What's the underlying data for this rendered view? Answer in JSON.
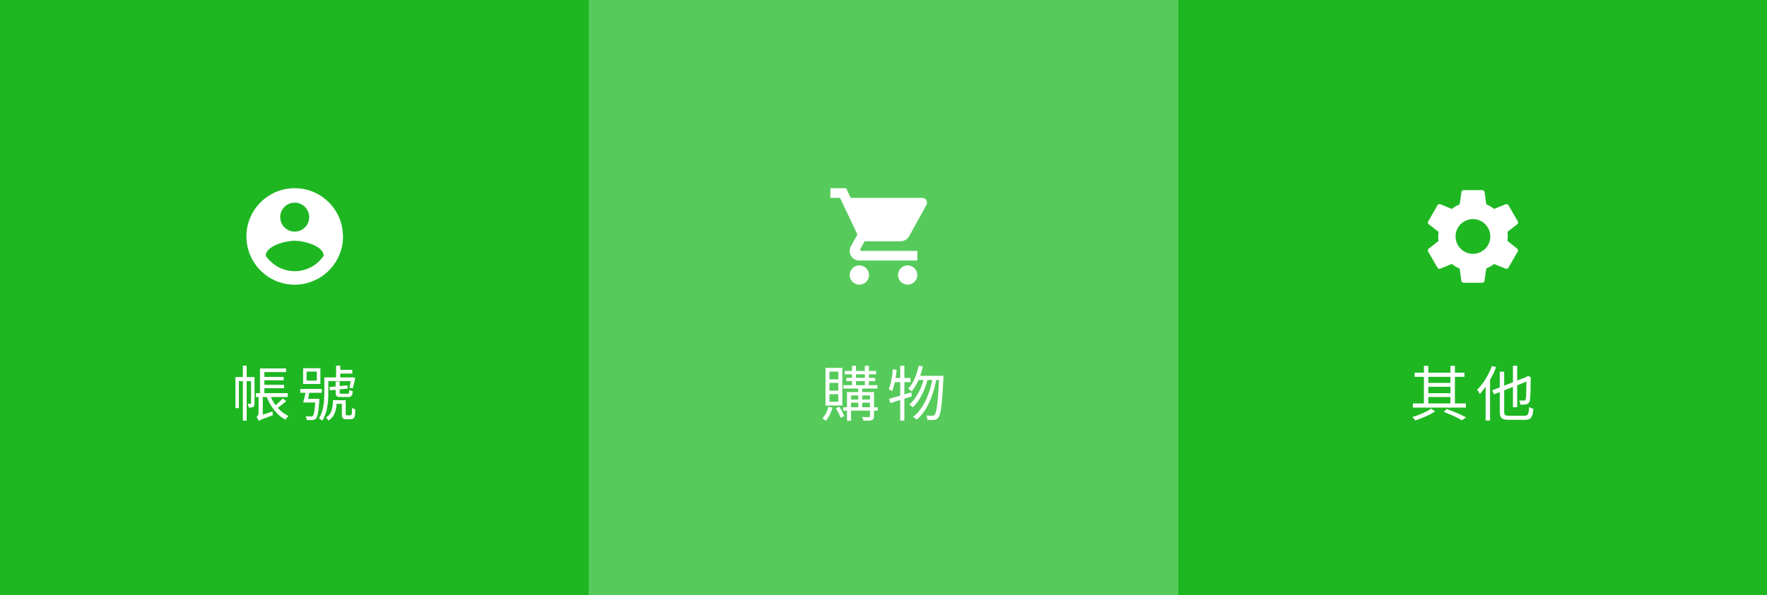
{
  "colors": {
    "background": "#1eb722",
    "selected_background": "#56cb5b",
    "foreground": "#ffffff"
  },
  "tabs": [
    {
      "label": "帳號",
      "icon": "account-circle-icon",
      "selected": false
    },
    {
      "label": "購物",
      "icon": "shopping-cart-icon",
      "selected": true
    },
    {
      "label": "其他",
      "icon": "settings-gear-icon",
      "selected": false
    }
  ]
}
